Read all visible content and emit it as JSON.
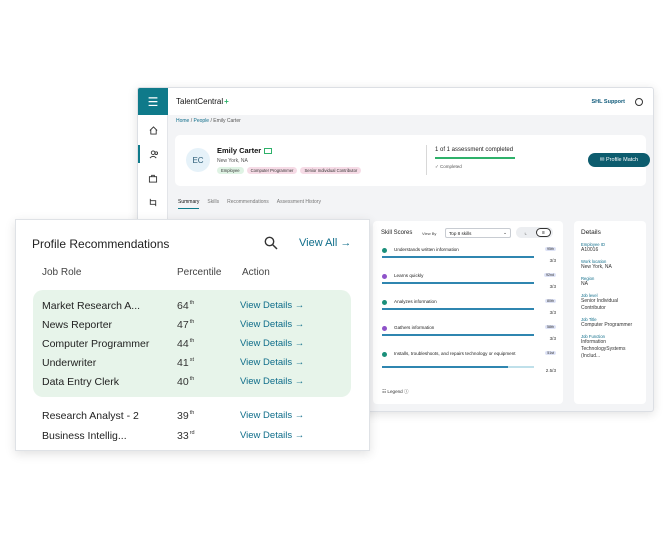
{
  "app": {
    "brand": "TalentCentral",
    "brand_plus": "+",
    "support": "SHL Support",
    "breadcrumb": [
      {
        "label": "Home"
      },
      {
        "label": "People"
      },
      {
        "label": "Emily Carter"
      }
    ]
  },
  "profile": {
    "initials": "EC",
    "name": "Emily Carter",
    "location": "New York, NA",
    "tags": [
      "Employee",
      "Computer Programmer",
      "Senior Individual Contributor"
    ],
    "assessment": "1 of 1 assessment completed",
    "status": "Completed",
    "profile_match": "Profile Match"
  },
  "tabs": [
    "Summary",
    "Skills",
    "Recommendations",
    "Assessment History"
  ],
  "skills_panel": {
    "title": "Skill Scores",
    "view_by": "View By",
    "view_option": "Top 8 skills",
    "legend": "Legend",
    "items": [
      {
        "name": "Understands written information",
        "pct": "95th",
        "score": "3/3",
        "fraction": 1.0,
        "color": "#1b8f7a"
      },
      {
        "name": "Learns quickly",
        "pct": "92nd",
        "score": "3/3",
        "fraction": 1.0,
        "color": "#8e53c9"
      },
      {
        "name": "Analyzes information",
        "pct": "80th",
        "score": "3/3",
        "fraction": 1.0,
        "color": "#1b8f7a"
      },
      {
        "name": "Gathers information",
        "pct": "58th",
        "score": "3/3",
        "fraction": 1.0,
        "color": "#8e53c9"
      },
      {
        "name": "Installs, troubleshoots, and repairs technology or equipment",
        "pct": "51st",
        "score": "2.5/3",
        "fraction": 0.83,
        "color": "#1b8f7a"
      }
    ]
  },
  "details": {
    "title": "Details",
    "fields": [
      {
        "label": "Employee ID",
        "value": "A10016"
      },
      {
        "label": "Work location",
        "value": "New York, NA"
      },
      {
        "label": "Region",
        "value": "NA"
      },
      {
        "label": "Job level",
        "value": "Senior Individual Contributor"
      },
      {
        "label": "Job Title",
        "value": "Computer Programmer"
      },
      {
        "label": "Job Function",
        "value": "Information TechnologySystems (Includ..."
      }
    ]
  },
  "recommendations": {
    "title": "Profile Recommendations",
    "view_all": "View All",
    "columns": {
      "role": "Job Role",
      "percentile": "Percentile",
      "action": "Action"
    },
    "highlighted": [
      {
        "role": "Market Research A...",
        "pct": "64",
        "suffix": "th",
        "action": "View Details"
      },
      {
        "role": "News Reporter",
        "pct": "47",
        "suffix": "th",
        "action": "View Details"
      },
      {
        "role": "Computer Programmer",
        "pct": "44",
        "suffix": "th",
        "action": "View Details"
      },
      {
        "role": "Underwriter",
        "pct": "41",
        "suffix": "st",
        "action": "View Details"
      },
      {
        "role": "Data Entry Clerk",
        "pct": "40",
        "suffix": "th",
        "action": "View Details"
      }
    ],
    "others": [
      {
        "role": "Research Analyst - 2",
        "pct": "39",
        "suffix": "th",
        "action": "View Details"
      },
      {
        "role": "Business Intellig...",
        "pct": "33",
        "suffix": "rd",
        "action": "View Details"
      }
    ]
  }
}
